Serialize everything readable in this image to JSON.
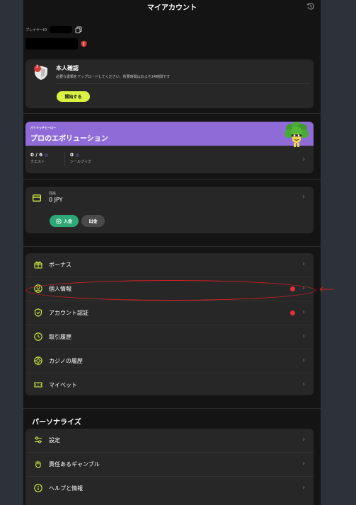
{
  "header": {
    "title": "マイアカウント",
    "history_icon": "history-icon"
  },
  "player": {
    "label": "プレイヤーID"
  },
  "kyc": {
    "title": "本人確認",
    "description": "必要な書類をアップロードしてください、所要時間はおよそ24時間です",
    "button": "開始する",
    "shield_badge": "!"
  },
  "evolution": {
    "tag": "パリマッチヒーロー",
    "title": "プロのエボリューション",
    "quests_value": "0 / 6",
    "quests_label": "クエスト",
    "sealbook_value": "0",
    "sealbook_label": "シールブック"
  },
  "wallet": {
    "label": "残高",
    "amount": "0 JPY",
    "deposit_label": "入金",
    "withdraw_label": "出金"
  },
  "menu": {
    "items": [
      {
        "label": "ボーナス",
        "icon": "gift-icon",
        "alert": false
      },
      {
        "label": "個人情報",
        "icon": "user-circle-icon",
        "alert": true
      },
      {
        "label": "アカウント認証",
        "icon": "shield-check-icon",
        "alert": true
      },
      {
        "label": "取引履歴",
        "icon": "clock-icon",
        "alert": false
      },
      {
        "label": "カジノの履歴",
        "icon": "casino-chip-icon",
        "alert": false
      },
      {
        "label": "マイベット",
        "icon": "ticket-icon",
        "alert": false
      }
    ]
  },
  "personalize": {
    "title": "パーソナライズ",
    "items": [
      {
        "label": "設定",
        "icon": "sliders-icon"
      },
      {
        "label": "責任あるギャンブル",
        "icon": "hand-icon"
      },
      {
        "label": "ヘルプと情報",
        "icon": "info-icon"
      }
    ]
  },
  "colors": {
    "accent_lime": "#d9f244",
    "accent_purple": "#8e6bd6",
    "accent_green": "#2fa877",
    "alert_red": "#e0333a"
  }
}
